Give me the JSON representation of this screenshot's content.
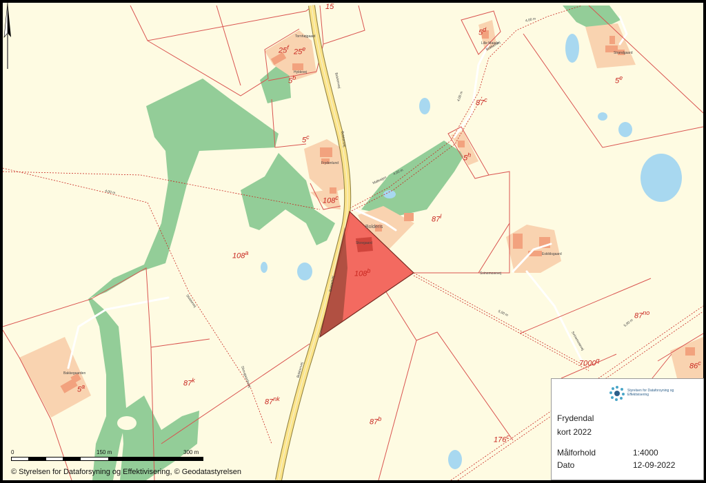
{
  "map": {
    "place_names": {
      "bolderis": "Bolderis",
      "frydenlund": "Frydenlund",
      "hyldevej": "Hyldevej",
      "strandgaard": "Strandgaard",
      "skovgaard": "Skovgaard",
      "bakkegaarden": "Bakkegaarden",
      "eskildsgaard": "Eskildsgaard",
      "tornhojgaard": "Tornhøjgaard",
      "lille_maade": "Lille Maade"
    },
    "road_names": {
      "bokkenvej_1": "Bokkenvej",
      "bokkenvej_2": "Bokkenvej",
      "bokkenvej_3": "Bokkenvej",
      "bokkenvej_4": "Bokkenvej",
      "maltvej": "Maltvejen",
      "svinemosevej_1": "Svinemosevej",
      "svinemosevej_2": "Svinemosevej",
      "stokkevej": "Stokkevej",
      "skovgaardsvej": "Skovgaardsvej",
      "stien": "Bokkenvej"
    },
    "width_labels": {
      "w1": "4,00 m",
      "w2": "4,00 m",
      "w3": "4,00 m",
      "w4": "4,00 m",
      "w5": "5,00 m",
      "w6": "5,00 m"
    },
    "parcels": [
      {
        "id": "p15",
        "num": "15",
        "sup": ""
      },
      {
        "id": "p25f",
        "num": "25",
        "sup": "f"
      },
      {
        "id": "p25e",
        "num": "25",
        "sup": "e"
      },
      {
        "id": "p5b",
        "num": "5",
        "sup": "b"
      },
      {
        "id": "p5d",
        "num": "5",
        "sup": "d"
      },
      {
        "id": "p5e",
        "num": "5",
        "sup": "e"
      },
      {
        "id": "p87c",
        "num": "87",
        "sup": "c"
      },
      {
        "id": "p5c",
        "num": "5",
        "sup": "c"
      },
      {
        "id": "p5h",
        "num": "5",
        "sup": "h"
      },
      {
        "id": "p108c",
        "num": "108",
        "sup": "c"
      },
      {
        "id": "p87l",
        "num": "87",
        "sup": "l"
      },
      {
        "id": "p108a",
        "num": "108",
        "sup": "a"
      },
      {
        "id": "p108b",
        "num": "108",
        "sup": "b"
      },
      {
        "id": "p87no",
        "num": "87",
        "sup": "no"
      },
      {
        "id": "p7000q",
        "num": "7000",
        "sup": "q"
      },
      {
        "id": "p86c",
        "num": "86",
        "sup": "c"
      },
      {
        "id": "p5a",
        "num": "5",
        "sup": "a"
      },
      {
        "id": "p87k",
        "num": "87",
        "sup": "k"
      },
      {
        "id": "p87nk",
        "num": "87",
        "sup": "nk"
      },
      {
        "id": "p87b",
        "num": "87",
        "sup": "b"
      },
      {
        "id": "p176c",
        "num": "176",
        "sup": "c"
      }
    ],
    "colors": {
      "background": "#fefbe2",
      "forest": "#93cd98",
      "water": "#a8d8f0",
      "building": "#f2a27e",
      "yard": "#f9d3b0",
      "highlight_fill": "#f25a52",
      "road": "#fbe48a",
      "boundary": "#d9534f"
    }
  },
  "scalebar": {
    "zero": "0",
    "mid": "150 m",
    "max": "300 m"
  },
  "copyright": "© Styrelsen for Dataforsyning og Effektivisering, © Geodatastyrelsen",
  "legend": {
    "org_name": "Styrelsen for Dataforsyning og Effektivisering",
    "title_line1": "Frydendal",
    "title_line2": "kort 2022",
    "scale_label": "Målforhold",
    "scale_value": "1:4000",
    "date_label": "Dato",
    "date_value": "12-09-2022"
  }
}
